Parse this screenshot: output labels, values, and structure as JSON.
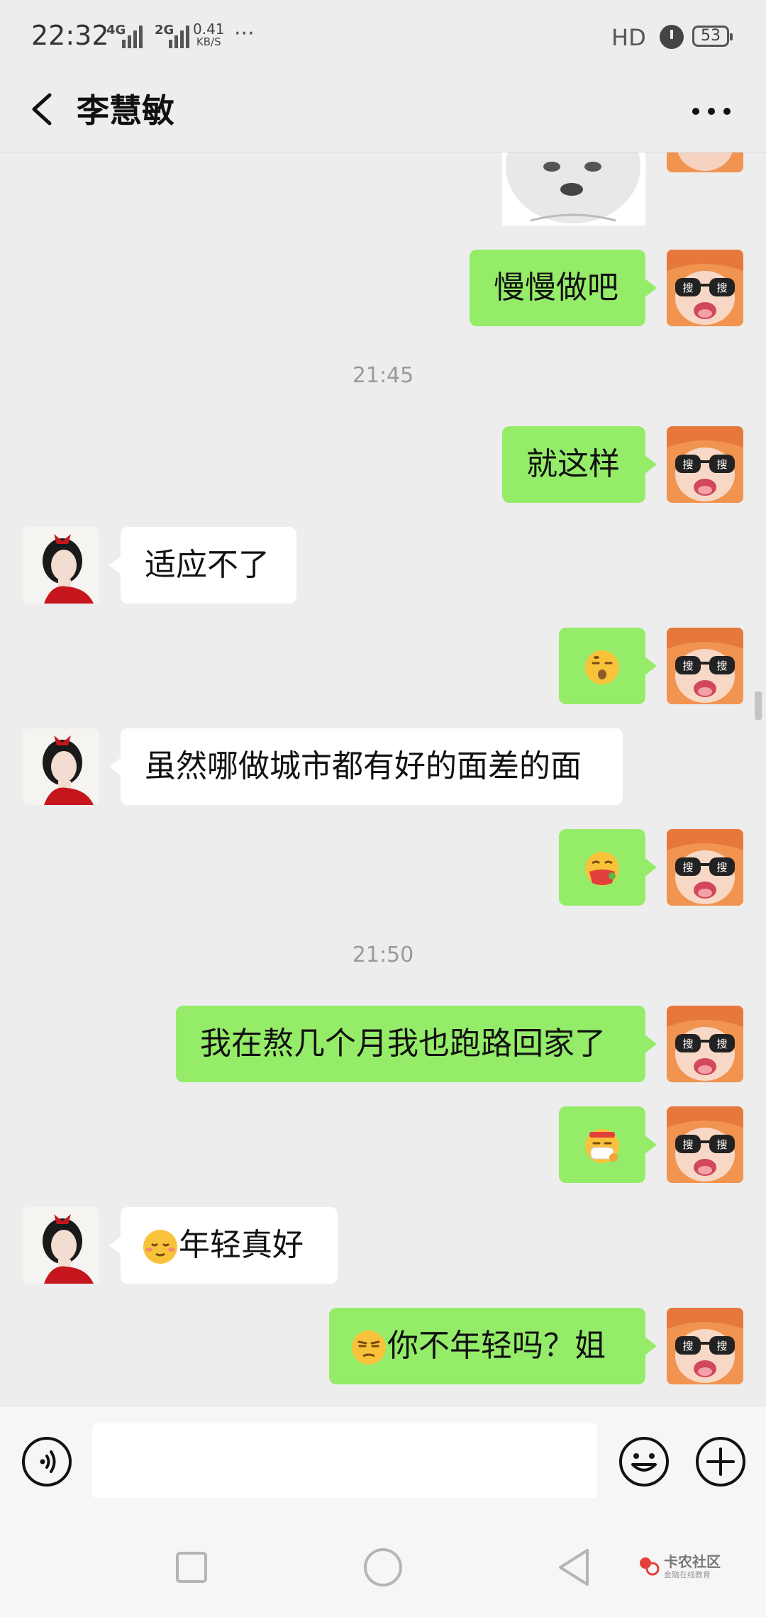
{
  "status_bar": {
    "time": "22:32",
    "net_4g": "4G",
    "net_2g": "2G",
    "speed_value": "0.41",
    "speed_unit": "KB/S",
    "more": "···",
    "hd": "HD",
    "battery": "53",
    "icons": [
      "signal-icon",
      "alarm-icon",
      "battery-icon"
    ]
  },
  "header": {
    "title": "李慧敏",
    "back_icon": "chevron-left-icon",
    "more_icon": "more-dots-icon"
  },
  "messages": {
    "m1": "慢慢做吧",
    "t1": "21:45",
    "m2": "就这样",
    "m3": "适应不了",
    "m4_emoji": "sleepy-drooling-face-emoji",
    "m5": "虽然哪做城市都有好的面差的面",
    "m6_emoji": "vomiting-face-emoji",
    "t2": "21:50",
    "m7": "我在熬几个月我也跑路回家了",
    "m8_emoji": "mask-face-emoji",
    "m9_emoji": "relieved-face-emoji",
    "m9_text": "年轻真好",
    "m10_emoji": "unamused-face-emoji",
    "m10_text": "你不年轻吗？姐"
  },
  "avatars": {
    "me": "anime-sunglasses-avatar",
    "me_glyph": "搜",
    "her": "girl-red-bow-avatar"
  },
  "input_bar": {
    "voice_icon": "voice-icon",
    "text_value": "",
    "emoji_icon": "smiley-icon",
    "plus_icon": "plus-circle-icon"
  },
  "nav_bar": {
    "icons": [
      "recent-apps-icon",
      "home-icon",
      "back-triangle-icon"
    ]
  },
  "watermark": {
    "title": "卡农社区",
    "subtitle": "金融在线教育"
  },
  "colors": {
    "background": "#ededed",
    "my_bubble": "#95ec69",
    "her_bubble": "#ffffff",
    "avatar_me": "#f09450"
  }
}
